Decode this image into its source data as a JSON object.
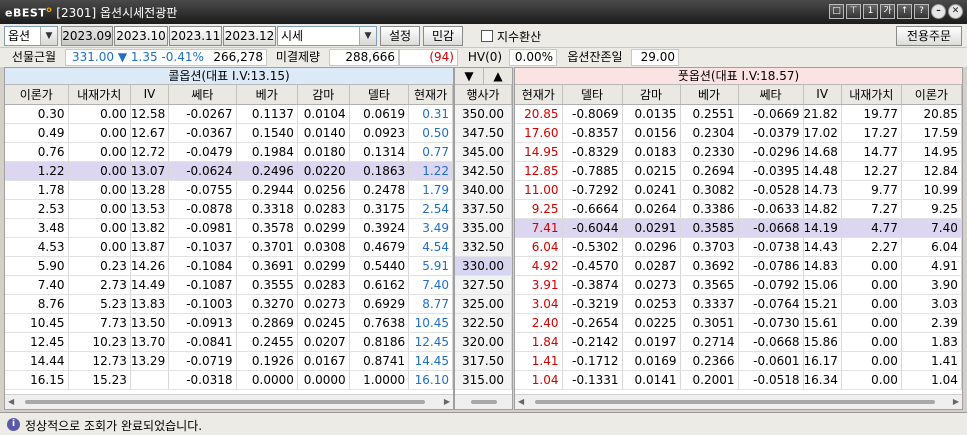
{
  "window": {
    "logo": "eBEST",
    "title": "[2301] 옵션시세전광판"
  },
  "toolbar": {
    "type_combo": "옵션",
    "months": [
      "2023.09",
      "2023.10",
      "2023.11",
      "2023.12"
    ],
    "view_combo": "시세",
    "settings_label": "설정",
    "sensitivity_label": "민감",
    "index_convert_label": "지수환산",
    "order_label": "전용주문"
  },
  "info": {
    "futures_label": "선물근월",
    "futures_price": "331.00",
    "futures_change": "1.35",
    "futures_pct": "-0.41%",
    "futures_volume": "266,278",
    "oi_label": "미결제량",
    "oi_value": "288,666",
    "oi_change": "(94)",
    "hv_label": "HV(0)",
    "hv_value": "0.00%",
    "days_label": "옵션잔존일",
    "days_value": "29.00"
  },
  "call": {
    "banner": "콜옵션(대표 I.V:13.15)",
    "headers": [
      "이론가",
      "내재가치",
      "IV",
      "쎄타",
      "베가",
      "감마",
      "델타",
      "현재가"
    ],
    "rows": [
      [
        "0.30",
        "0.00",
        "12.58",
        "-0.0267",
        "0.1137",
        "0.0104",
        "0.0619",
        "0.31"
      ],
      [
        "0.49",
        "0.00",
        "12.67",
        "-0.0367",
        "0.1540",
        "0.0140",
        "0.0923",
        "0.50"
      ],
      [
        "0.76",
        "0.00",
        "12.72",
        "-0.0479",
        "0.1984",
        "0.0180",
        "0.1314",
        "0.77"
      ],
      [
        "1.22",
        "0.00",
        "13.07",
        "-0.0624",
        "0.2496",
        "0.0220",
        "0.1863",
        "1.22"
      ],
      [
        "1.78",
        "0.00",
        "13.28",
        "-0.0755",
        "0.2944",
        "0.0256",
        "0.2478",
        "1.79"
      ],
      [
        "2.53",
        "0.00",
        "13.53",
        "-0.0878",
        "0.3318",
        "0.0283",
        "0.3175",
        "2.54"
      ],
      [
        "3.48",
        "0.00",
        "13.82",
        "-0.0981",
        "0.3578",
        "0.0299",
        "0.3924",
        "3.49"
      ],
      [
        "4.53",
        "0.00",
        "13.87",
        "-0.1037",
        "0.3701",
        "0.0308",
        "0.4679",
        "4.54"
      ],
      [
        "5.90",
        "0.23",
        "14.26",
        "-0.1084",
        "0.3691",
        "0.0299",
        "0.5440",
        "5.91"
      ],
      [
        "7.40",
        "2.73",
        "14.49",
        "-0.1087",
        "0.3555",
        "0.0283",
        "0.6162",
        "7.40"
      ],
      [
        "8.76",
        "5.23",
        "13.83",
        "-0.1003",
        "0.3270",
        "0.0273",
        "0.6929",
        "8.77"
      ],
      [
        "10.45",
        "7.73",
        "13.50",
        "-0.0913",
        "0.2869",
        "0.0245",
        "0.7638",
        "10.45"
      ],
      [
        "12.45",
        "10.23",
        "13.70",
        "-0.0841",
        "0.2455",
        "0.0207",
        "0.8186",
        "12.45"
      ],
      [
        "14.44",
        "12.73",
        "13.29",
        "-0.0719",
        "0.1926",
        "0.0167",
        "0.8741",
        "14.45"
      ],
      [
        "16.15",
        "15.23",
        "",
        "-0.0318",
        "0.0000",
        "0.0000",
        "1.0000",
        "16.10"
      ]
    ]
  },
  "strike": {
    "header": "행사가",
    "values": [
      "350.00",
      "347.50",
      "345.00",
      "342.50",
      "340.00",
      "337.50",
      "335.00",
      "332.50",
      "330.00",
      "327.50",
      "325.00",
      "322.50",
      "320.00",
      "317.50",
      "315.00"
    ]
  },
  "put": {
    "banner": "풋옵션(대표 I.V:18.57)",
    "headers": [
      "현재가",
      "델타",
      "감마",
      "베가",
      "쎄타",
      "IV",
      "내재가치",
      "이론가"
    ],
    "rows": [
      [
        "20.85",
        "-0.8069",
        "0.0135",
        "0.2551",
        "-0.0669",
        "21.82",
        "19.77",
        "20.85"
      ],
      [
        "17.60",
        "-0.8357",
        "0.0156",
        "0.2304",
        "-0.0379",
        "17.02",
        "17.27",
        "17.59"
      ],
      [
        "14.95",
        "-0.8329",
        "0.0183",
        "0.2330",
        "-0.0296",
        "14.68",
        "14.77",
        "14.95"
      ],
      [
        "12.85",
        "-0.7885",
        "0.0215",
        "0.2694",
        "-0.0395",
        "14.48",
        "12.27",
        "12.84"
      ],
      [
        "11.00",
        "-0.7292",
        "0.0241",
        "0.3082",
        "-0.0528",
        "14.73",
        "9.77",
        "10.99"
      ],
      [
        "9.25",
        "-0.6664",
        "0.0264",
        "0.3386",
        "-0.0633",
        "14.82",
        "7.27",
        "9.25"
      ],
      [
        "7.41",
        "-0.6044",
        "0.0291",
        "0.3585",
        "-0.0668",
        "14.19",
        "4.77",
        "7.40"
      ],
      [
        "6.04",
        "-0.5302",
        "0.0296",
        "0.3703",
        "-0.0738",
        "14.43",
        "2.27",
        "6.04"
      ],
      [
        "4.92",
        "-0.4570",
        "0.0287",
        "0.3692",
        "-0.0786",
        "14.83",
        "0.00",
        "4.91"
      ],
      [
        "3.91",
        "-0.3874",
        "0.0273",
        "0.3565",
        "-0.0792",
        "15.06",
        "0.00",
        "3.90"
      ],
      [
        "3.04",
        "-0.3219",
        "0.0253",
        "0.3337",
        "-0.0764",
        "15.21",
        "0.00",
        "3.03"
      ],
      [
        "2.40",
        "-0.2654",
        "0.0225",
        "0.3051",
        "-0.0730",
        "15.61",
        "0.00",
        "2.39"
      ],
      [
        "1.84",
        "-0.2142",
        "0.0197",
        "0.2714",
        "-0.0668",
        "15.86",
        "0.00",
        "1.83"
      ],
      [
        "1.41",
        "-0.1712",
        "0.0169",
        "0.2366",
        "-0.0601",
        "16.17",
        "0.00",
        "1.41"
      ],
      [
        "1.04",
        "-0.1331",
        "0.0141",
        "0.2001",
        "-0.0518",
        "16.34",
        "0.00",
        "1.04"
      ]
    ]
  },
  "status": {
    "text": "정상적으로 조회가 완료되었습니다."
  },
  "colors": {
    "call_price": "#1f6fc8",
    "put_price": "#d20000",
    "futures_blue": "#1f6fc8",
    "oi_red": "#d20000",
    "highlight": "#ddd6f0"
  }
}
